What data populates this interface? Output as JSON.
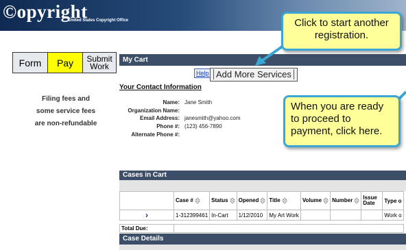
{
  "header": {
    "logo_text": "©opyright",
    "logo_sub": "United States Copyright Office"
  },
  "steps": [
    {
      "label": "Form"
    },
    {
      "label": "Pay"
    },
    {
      "label": "Submit",
      "label2": "Work"
    }
  ],
  "fees_note": [
    "Filing fees and",
    "some service fees",
    "are non-refundable"
  ],
  "cart": {
    "title": "My Cart",
    "help_label": "Help",
    "add_more_label": "Add More Services",
    "contact_heading": "Your Contact Information",
    "contact_fields": [
      {
        "label": "Name:",
        "value": "Jane Smith"
      },
      {
        "label": "Organization Name:",
        "value": ""
      },
      {
        "label": "Email Address:",
        "value": "janesmith@yahoo.com"
      },
      {
        "label": "Phone #:",
        "value": "(123) 456-7890"
      },
      {
        "label": "Alternate Phone #:",
        "value": ""
      }
    ]
  },
  "callouts": {
    "another_registration": "Click to start another registration.",
    "proceed_payment": "When you are ready to proceed to payment, click here."
  },
  "cases": {
    "title": "Cases in Cart",
    "columns": [
      "Case #",
      "Status",
      "Opened",
      "Title",
      "Volume",
      "Number",
      "Issue Date",
      "Type o"
    ],
    "rows": [
      {
        "expand": "›",
        "case": "1-312399461",
        "status": "In-Cart",
        "opened": "1/12/2010",
        "title": "My Art Work",
        "volume": "",
        "number": "",
        "issue": "",
        "type": "Work o"
      }
    ],
    "total_label": "Total Due:",
    "details_title": "Case Details"
  }
}
